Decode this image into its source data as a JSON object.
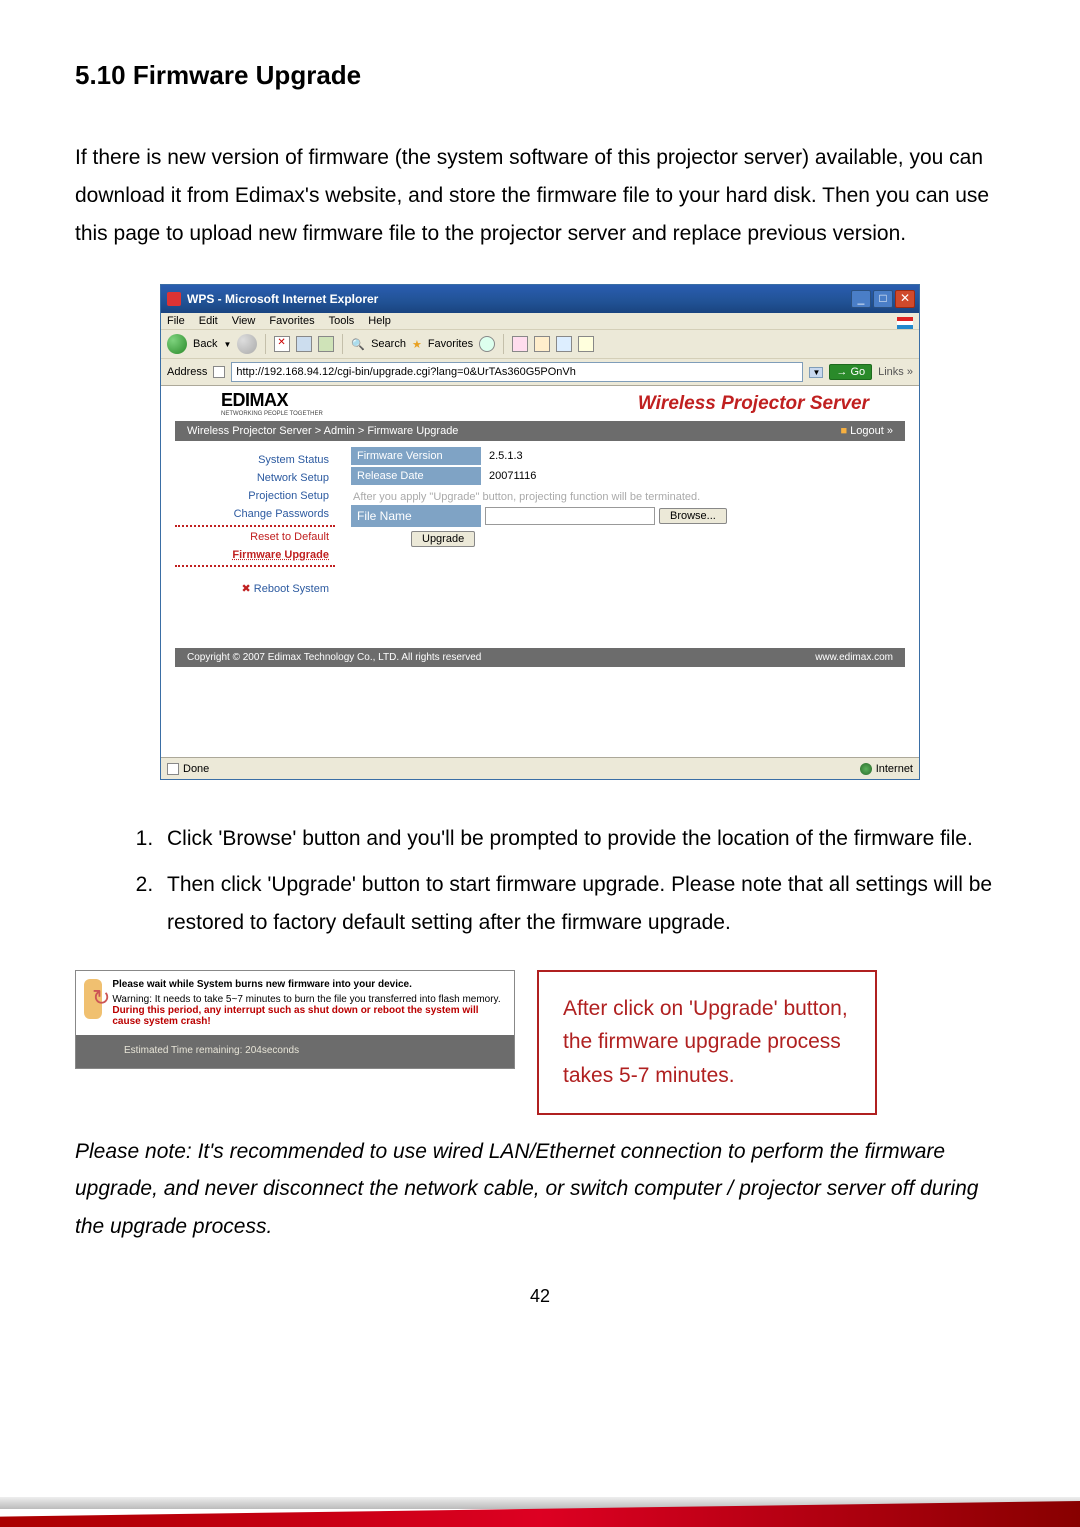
{
  "header": {
    "title": "5.10 Firmware Upgrade"
  },
  "intro": "If there is new version of firmware (the system software of this projector server) available, you can download it from Edimax's website, and store the firmware file to your hard disk. Then you can use this page to upload new firmware file to the projector server and replace previous version.",
  "browser": {
    "title": "WPS - Microsoft Internet Explorer",
    "minimize": "_",
    "maximize": "□",
    "close": "✕",
    "menu": {
      "file": "File",
      "edit": "Edit",
      "view": "View",
      "favorites": "Favorites",
      "tools": "Tools",
      "help": "Help"
    },
    "toolbar": {
      "back": "Back",
      "search": "Search",
      "fav": "Favorites"
    },
    "address_label": "Address",
    "url": "http://192.168.94.12/cgi-bin/upgrade.cgi?lang=0&UrTAs360G5POnVh",
    "go": "Go",
    "links": "Links",
    "status_done": "Done",
    "status_zone": "Internet"
  },
  "page": {
    "logo": "EDIMAX",
    "logo_sub": "NETWORKING PEOPLE TOGETHER",
    "product": "Wireless Projector Server",
    "breadcrumb": "Wireless Projector Server > Admin > Firmware Upgrade",
    "logout": "Logout »",
    "sidebar": {
      "items": [
        "System Status",
        "Network Setup",
        "Projection Setup",
        "Change Passwords",
        "Reset to Default",
        "Firmware Upgrade",
        "Reboot System"
      ]
    },
    "form": {
      "fw_ver_label": "Firmware Version",
      "fw_ver": "2.5.1.3",
      "rel_label": "Release Date",
      "rel": "20071116",
      "note": "After you apply \"Upgrade\" button, projecting function will be terminated.",
      "file_label": "File Name",
      "browse": "Browse...",
      "upgrade": "Upgrade"
    },
    "copyright": "Copyright © 2007 Edimax Technology Co., LTD. All rights reserved",
    "site": "www.edimax.com"
  },
  "steps": [
    "Click 'Browse' button and you'll be prompted to provide the location of the firmware file.",
    "Then click 'Upgrade' button to start firmware upgrade. Please note that all settings will be restored to factory default setting after the firmware upgrade."
  ],
  "waitbox": {
    "line1": "Please wait while System burns new firmware into your device.",
    "line2a": "Warning: It needs to take 5~7 minutes to burn the file you transferred into flash memory. ",
    "line2b": "During this period, any interrupt such as shut down or reboot the system will cause system crash!",
    "line3": "Estimated Time remaining: 204seconds"
  },
  "callout": "After click on 'Upgrade' button, the firmware upgrade process takes 5-7 minutes.",
  "note": "Please note: It's recommended to use wired LAN/Ethernet connection to perform the firmware upgrade, and never disconnect the network cable, or switch computer / projector server off during the upgrade process.",
  "page_num": "42"
}
